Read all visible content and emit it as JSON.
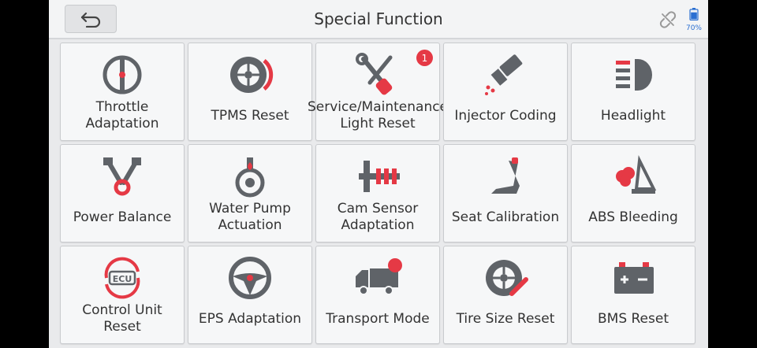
{
  "header": {
    "title": "Special Function",
    "battery_label": "70%",
    "battery_level": 0.7
  },
  "colors": {
    "accent_red": "#e53945",
    "icon_gray": "#5f6368",
    "battery_blue": "#2b6fd1"
  },
  "functions": [
    {
      "label": "Throttle Adaptation",
      "icon": "throttle-icon"
    },
    {
      "label": "TPMS Reset",
      "icon": "tire-pressure-icon"
    },
    {
      "label": "Service/Maintenance Light Reset",
      "icon": "wrench-screwdriver-icon",
      "badge": "1"
    },
    {
      "label": "Injector Coding",
      "icon": "injector-icon"
    },
    {
      "label": "Headlight",
      "icon": "headlight-icon"
    },
    {
      "label": "Power Balance",
      "icon": "power-balance-icon"
    },
    {
      "label": "Water Pump Actuation",
      "icon": "water-pump-icon"
    },
    {
      "label": "Cam Sensor Adaptation",
      "icon": "camshaft-icon"
    },
    {
      "label": "Seat Calibration",
      "icon": "seat-icon"
    },
    {
      "label": "ABS Bleeding",
      "icon": "abs-bleeding-icon"
    },
    {
      "label": "Control Unit Reset",
      "icon": "ecu-reset-icon"
    },
    {
      "label": "EPS Adaptation",
      "icon": "steering-wheel-icon"
    },
    {
      "label": "Transport Mode",
      "icon": "truck-icon"
    },
    {
      "label": "Tire Size Reset",
      "icon": "tire-wrench-icon"
    },
    {
      "label": "BMS Reset",
      "icon": "battery-icon"
    }
  ]
}
